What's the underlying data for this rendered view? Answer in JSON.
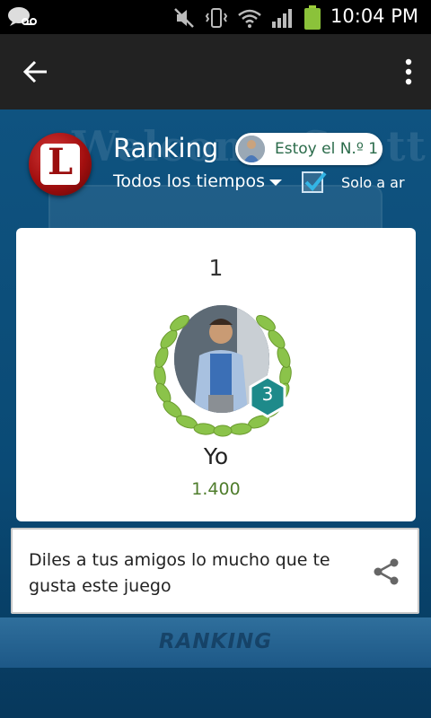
{
  "status_bar": {
    "time": "10:04 PM"
  },
  "action_bar": {
    "back_icon": "arrow-left-icon",
    "menu_icon": "more-vertical-icon"
  },
  "background": {
    "welcome_text": "Welcome Scott",
    "bottom_label": "RANKING"
  },
  "header": {
    "logo_letter": "L",
    "title": "Ranking",
    "rank_pill_label": "Estoy el N.º 1",
    "filter_label": "Todos los tiempos",
    "checkbox_checked": true,
    "checkbox_label": "Solo a ar"
  },
  "leaderboard": {
    "rank": "1",
    "player_name": "Yo",
    "score": "1.400",
    "level": "3",
    "badge_color": "#1e8a8a",
    "score_color": "#4f7d2c"
  },
  "share": {
    "text": "Diles a tus amigos lo mucho que te gusta este juego",
    "icon": "share-icon"
  }
}
